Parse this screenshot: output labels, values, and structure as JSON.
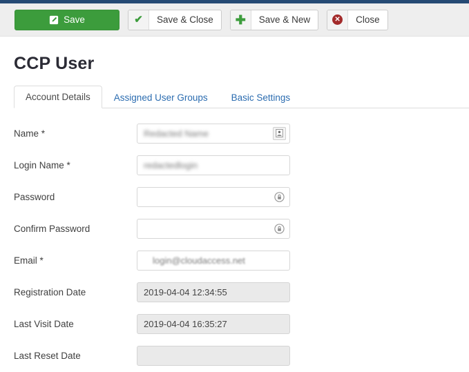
{
  "theme": {
    "top_strip_color": "#254a74",
    "toolbar_bg": "#eeeeee",
    "save_green": "#3c9c3c",
    "close_red": "#a32b2b",
    "tab_link_color": "#2b6cb0",
    "disabled_field_bg": "#eaeaea"
  },
  "toolbar": {
    "buttons": [
      {
        "label": "Save",
        "icon": "pencil-square-icon",
        "style": "primary"
      },
      {
        "label": "Save & Close",
        "icon": "check-icon",
        "style": "split"
      },
      {
        "label": "Save & New",
        "icon": "plus-icon",
        "style": "split"
      },
      {
        "label": "Close",
        "icon": "close-circle-icon",
        "style": "split"
      }
    ]
  },
  "page": {
    "title": "CCP User"
  },
  "tabs": [
    {
      "label": "Account Details",
      "active": true
    },
    {
      "label": "Assigned User Groups",
      "active": false
    },
    {
      "label": "Basic Settings",
      "active": false
    }
  ],
  "form": {
    "fields": [
      {
        "label": "Name",
        "required": true,
        "value": "Redacted Name",
        "redacted": true,
        "disabled": false,
        "addon_icon": "contact-card-icon"
      },
      {
        "label": "Login Name",
        "required": true,
        "value": "redactedlogin",
        "redacted": true,
        "disabled": false,
        "addon_icon": ""
      },
      {
        "label": "Password",
        "required": false,
        "value": "",
        "redacted": false,
        "disabled": false,
        "addon_icon": "padlock-icon"
      },
      {
        "label": "Confirm Password",
        "required": false,
        "value": "",
        "redacted": false,
        "disabled": false,
        "addon_icon": "padlock-icon"
      },
      {
        "label": "Email",
        "required": true,
        "value": "login@cloudaccess.net",
        "value_prefix": "",
        "value_blurred_head": "",
        "redacted": "partial",
        "disabled": false,
        "addon_icon": ""
      },
      {
        "label": "Registration Date",
        "required": false,
        "value": "2019-04-04 12:34:55",
        "redacted": false,
        "disabled": true,
        "addon_icon": ""
      },
      {
        "label": "Last Visit Date",
        "required": false,
        "value": "2019-04-04 16:35:27",
        "redacted": false,
        "disabled": true,
        "addon_icon": ""
      },
      {
        "label": "Last Reset Date",
        "required": false,
        "value": "",
        "redacted": false,
        "disabled": true,
        "addon_icon": ""
      }
    ]
  }
}
